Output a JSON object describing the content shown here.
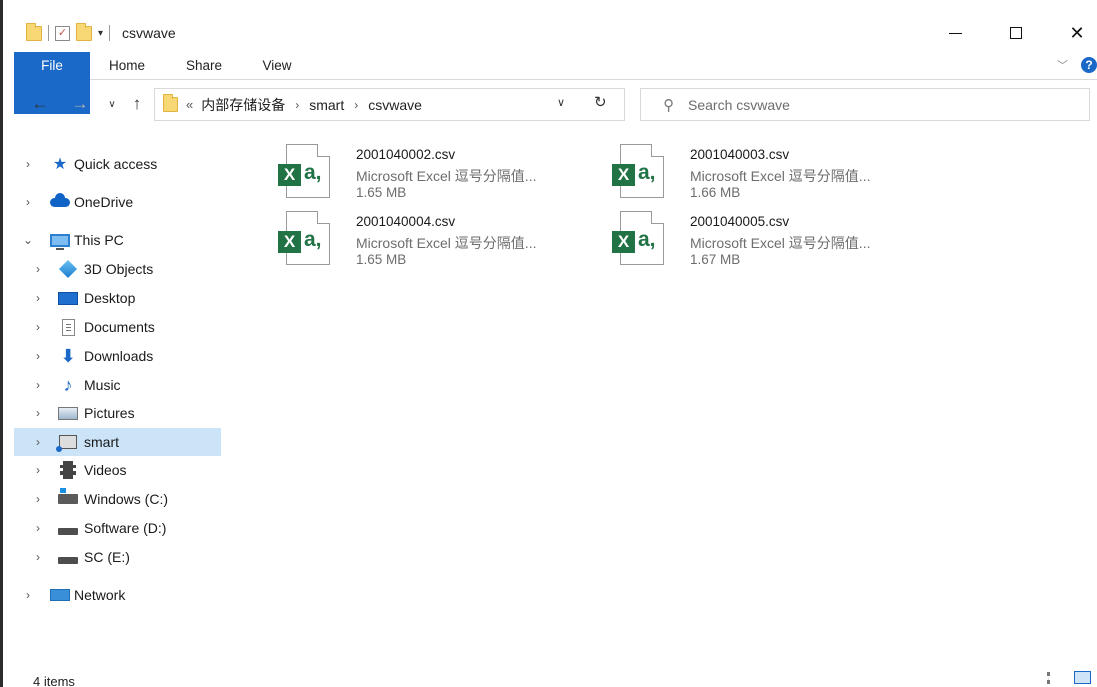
{
  "window": {
    "title": "csvwave"
  },
  "quick_toolbar": {
    "customize_label": "▾"
  },
  "ribbon": {
    "tabs": [
      {
        "label": "File"
      },
      {
        "label": "Home"
      },
      {
        "label": "Share"
      },
      {
        "label": "View"
      }
    ],
    "help": "?"
  },
  "address": {
    "overflow": "«",
    "crumbs": [
      "内部存储设备",
      "smart",
      "csvwave"
    ],
    "separator": "›"
  },
  "search": {
    "placeholder": "Search csvwave"
  },
  "sidebar": {
    "items": [
      {
        "label": "Quick access",
        "icon": "star-icon",
        "level": 0,
        "selected": false,
        "expanded": false
      },
      {
        "label": "OneDrive",
        "icon": "cloud-icon",
        "level": 0,
        "selected": false,
        "expanded": false
      },
      {
        "label": "This PC",
        "icon": "computer-icon",
        "level": 0,
        "selected": false,
        "expanded": true
      },
      {
        "label": "3D Objects",
        "icon": "cube-icon",
        "level": 1,
        "selected": false,
        "expanded": false
      },
      {
        "label": "Desktop",
        "icon": "desktop-icon",
        "level": 1,
        "selected": false,
        "expanded": false
      },
      {
        "label": "Documents",
        "icon": "document-icon",
        "level": 1,
        "selected": false,
        "expanded": false
      },
      {
        "label": "Downloads",
        "icon": "download-arrow-icon",
        "level": 1,
        "selected": false,
        "expanded": false
      },
      {
        "label": "Music",
        "icon": "music-note-icon",
        "level": 1,
        "selected": false,
        "expanded": false
      },
      {
        "label": "Pictures",
        "icon": "picture-icon",
        "level": 1,
        "selected": false,
        "expanded": false
      },
      {
        "label": "smart",
        "icon": "network-drive-icon",
        "level": 1,
        "selected": true,
        "expanded": false
      },
      {
        "label": "Videos",
        "icon": "film-icon",
        "level": 1,
        "selected": false,
        "expanded": false
      },
      {
        "label": "Windows (C:)",
        "icon": "windows-drive-icon",
        "level": 1,
        "selected": false,
        "expanded": false
      },
      {
        "label": "Software (D:)",
        "icon": "drive-icon",
        "level": 1,
        "selected": false,
        "expanded": false
      },
      {
        "label": "SC (E:)",
        "icon": "drive-icon",
        "level": 1,
        "selected": false,
        "expanded": false
      },
      {
        "label": "Network",
        "icon": "network-icon",
        "level": 0,
        "selected": false,
        "expanded": false
      }
    ]
  },
  "files": [
    {
      "name": "2001040002.csv",
      "type": "Microsoft Excel 逗号分隔值...",
      "size": "1.65 MB"
    },
    {
      "name": "2001040003.csv",
      "type": "Microsoft Excel 逗号分隔值...",
      "size": "1.66 MB"
    },
    {
      "name": "2001040004.csv",
      "type": "Microsoft Excel 逗号分隔值...",
      "size": "1.65 MB"
    },
    {
      "name": "2001040005.csv",
      "type": "Microsoft Excel 逗号分隔值...",
      "size": "1.67 MB"
    }
  ],
  "file_icon": {
    "badge": "X",
    "glyph": "a,"
  },
  "status": {
    "item_count": "4 items"
  },
  "colors": {
    "accent": "#1a68c7",
    "selection": "#cce4f7",
    "excel_green": "#217346"
  }
}
